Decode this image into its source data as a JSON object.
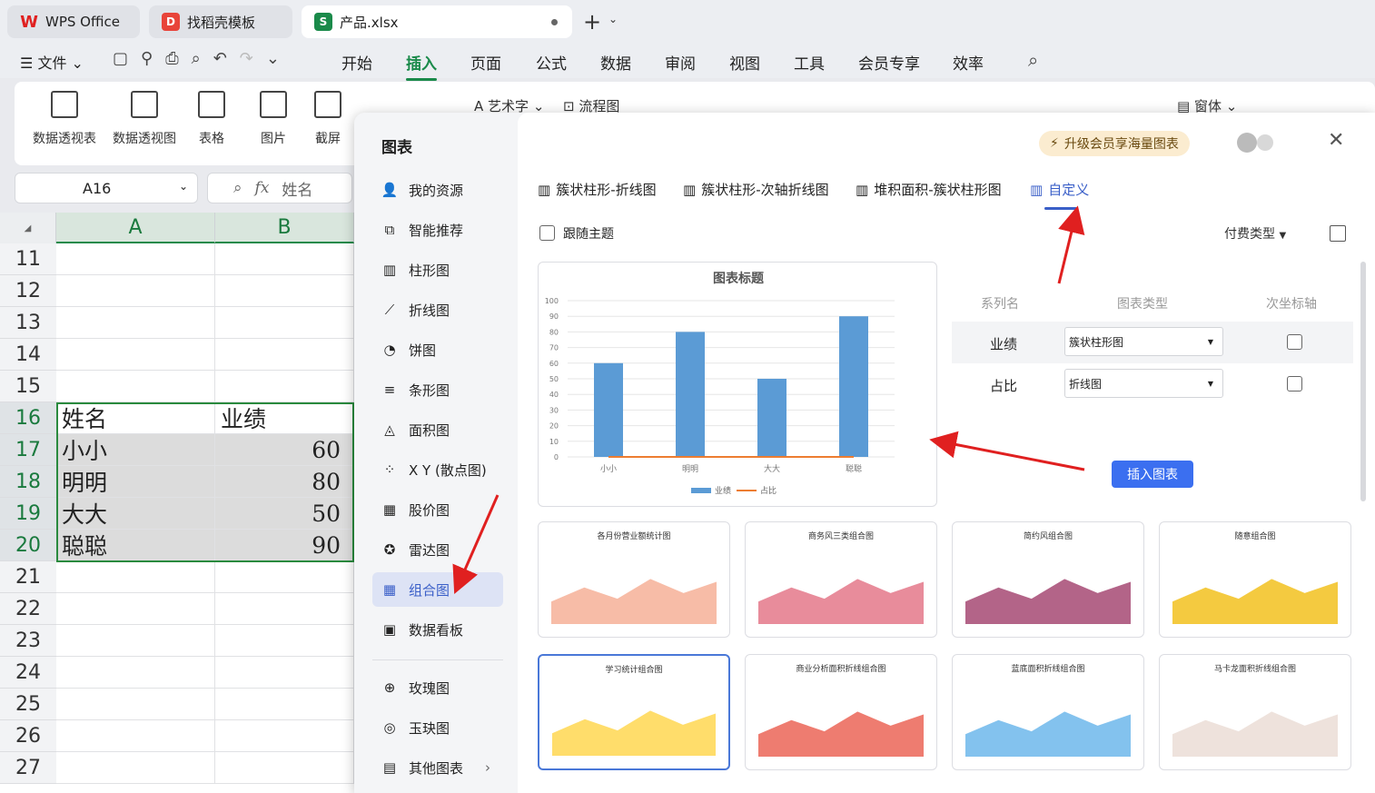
{
  "tabs": [
    {
      "label": "WPS Office",
      "logo": "W"
    },
    {
      "label": "找稻壳模板",
      "logo": "D"
    },
    {
      "label": "产品.xlsx",
      "logo": "S"
    }
  ],
  "menu": {
    "file": "文件",
    "tabs": [
      "开始",
      "插入",
      "页面",
      "公式",
      "数据",
      "审阅",
      "视图",
      "工具",
      "会员专享",
      "效率"
    ],
    "active": "插入"
  },
  "ribbon": {
    "buttons": [
      "数据透视表",
      "数据透视图",
      "表格",
      "图片",
      "截屏"
    ],
    "partial": [
      "艺术字",
      "流程图",
      "窗体"
    ]
  },
  "formula": {
    "cell_ref": "A16",
    "content": "姓名",
    "fx": "fx"
  },
  "sheet": {
    "columns": [
      "A",
      "B"
    ],
    "rows": [
      "11",
      "12",
      "13",
      "14",
      "15",
      "16",
      "17",
      "18",
      "19",
      "20",
      "21",
      "22",
      "23",
      "24",
      "25",
      "26",
      "27"
    ],
    "data": [
      {
        "row": "16",
        "a": "姓名",
        "b": "业绩"
      },
      {
        "row": "17",
        "a": "小小",
        "b": "60"
      },
      {
        "row": "18",
        "a": "明明",
        "b": "80"
      },
      {
        "row": "19",
        "a": "大大",
        "b": "50"
      },
      {
        "row": "20",
        "a": "聪聪",
        "b": "90"
      }
    ]
  },
  "dialog": {
    "title": "图表",
    "nav": [
      "我的资源",
      "智能推荐",
      "柱形图",
      "折线图",
      "饼图",
      "条形图",
      "面积图",
      "X Y (散点图)",
      "股价图",
      "雷达图",
      "组合图",
      "数据看板",
      "玫瑰图",
      "玉玦图",
      "其他图表"
    ],
    "nav_active": "组合图",
    "upgrade": "升级会员享海量图表",
    "chart_tabs": [
      "簇状柱形-折线图",
      "簇状柱形-次轴折线图",
      "堆积面积-簇状柱形图",
      "自定义"
    ],
    "chart_tab_active": "自定义",
    "follow_theme": "跟随主题",
    "paid_type": "付费类型",
    "table_headers": [
      "系列名",
      "图表类型",
      "次坐标轴"
    ],
    "series_rows": [
      {
        "name": "业绩",
        "type": "簇状柱形图"
      },
      {
        "name": "占比",
        "type": "折线图"
      }
    ],
    "insert_button": "插入图表",
    "templates": [
      "各月份营业额统计图",
      "商务风三类组合图",
      "简约风组合图",
      "随意组合图",
      "学习统计组合图",
      "商业分析面积折线组合图",
      "蓝底面积折线组合图",
      "马卡龙面积折线组合图"
    ]
  },
  "chart_data": {
    "type": "bar",
    "title": "图表标题",
    "categories": [
      "小小",
      "明明",
      "大大",
      "聪聪"
    ],
    "series": [
      {
        "name": "业绩",
        "values": [
          60,
          80,
          50,
          90
        ],
        "color": "#5b9bd5"
      },
      {
        "name": "占比",
        "values": [
          0,
          0,
          0,
          0
        ],
        "color": "#ed7d31"
      }
    ],
    "yticks": [
      0,
      10,
      20,
      30,
      40,
      50,
      60,
      70,
      80,
      90,
      100
    ],
    "ylim": [
      0,
      100
    ],
    "legend": "bottom"
  },
  "colors": {
    "accent": "#3a5fc8",
    "green": "#1a8a4a",
    "annotation": "#e02020"
  }
}
